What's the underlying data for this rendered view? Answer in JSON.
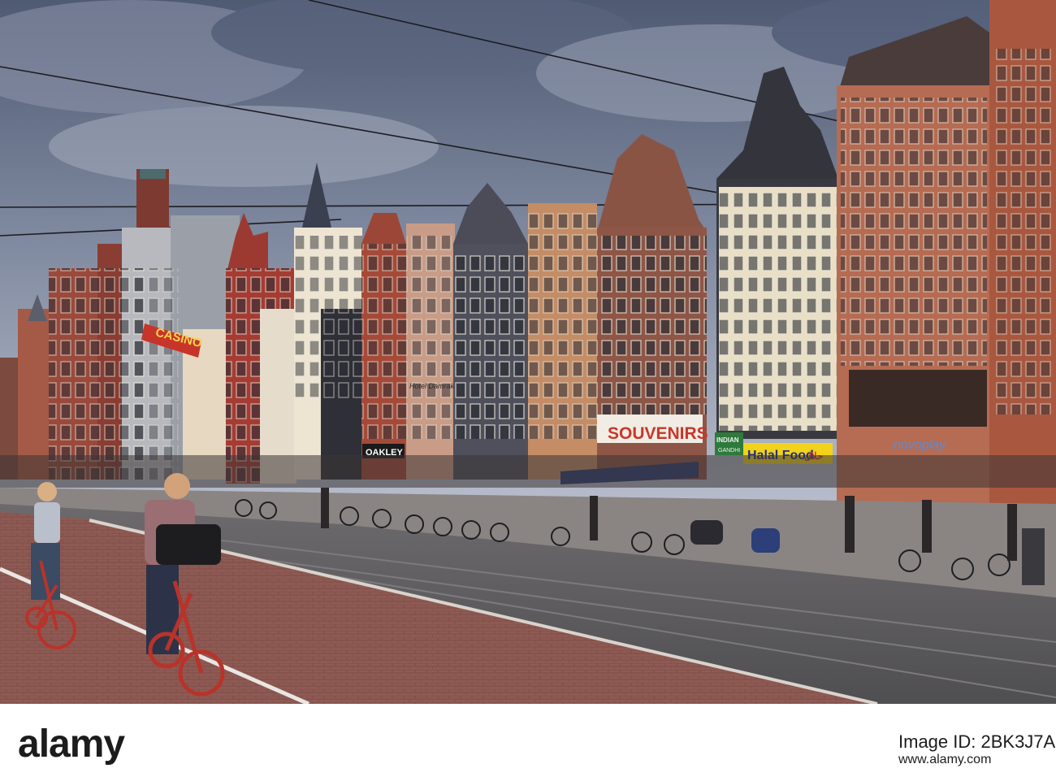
{
  "signs": {
    "casino": "CASINO",
    "souvenirs": "SOUVENIRS",
    "halal": "Halal Food",
    "halal_arabic": "حلال",
    "indian": "INDIAN",
    "gandhi": "GANDHI",
    "oakley": "OAKLEY",
    "novoplay": "novoplay",
    "hotel": "Hotel Damrak Inn"
  },
  "stock": {
    "logo": "alamy",
    "image_id": "Image ID: 2BK3J7A",
    "url": "www.alamy.com"
  },
  "colors": {
    "sky": "#6d7891",
    "road": "#5e5c5e",
    "bike_lane": "#8d5a55",
    "souvenir_sign": "#c8372a",
    "halal_sign": "#f2d21a"
  }
}
